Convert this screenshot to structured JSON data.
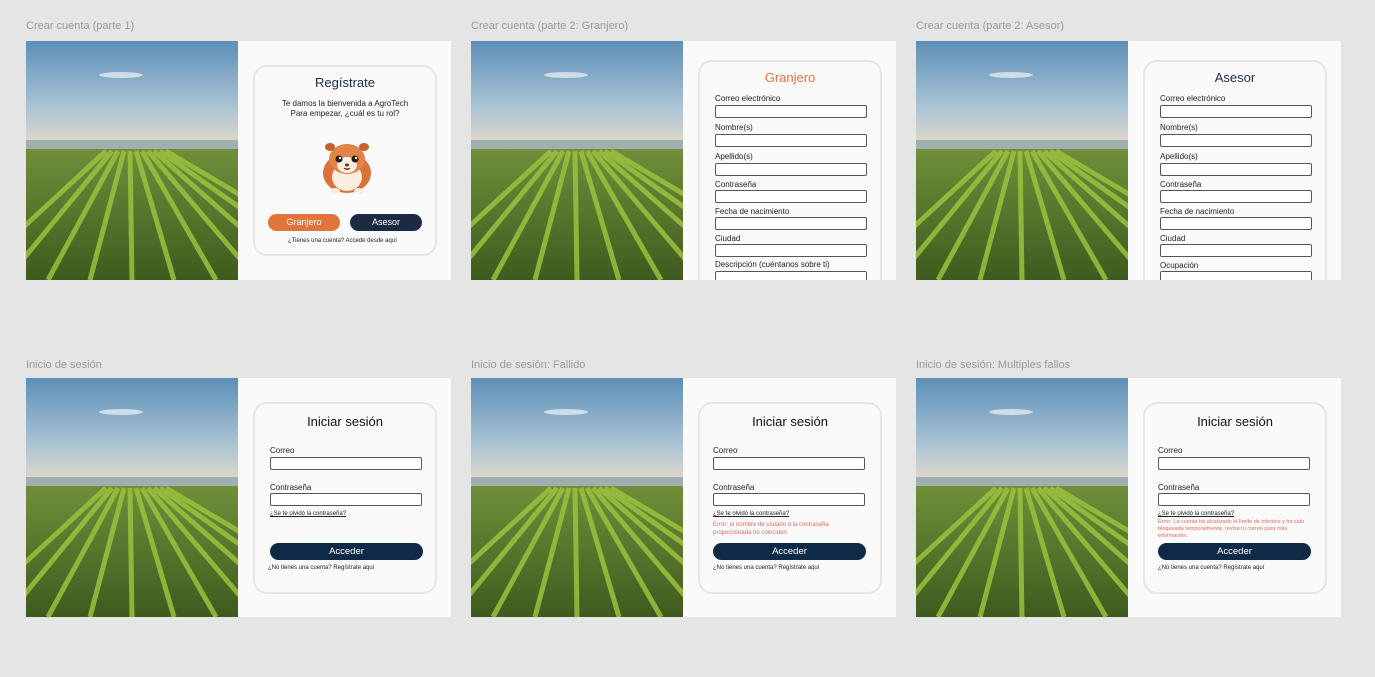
{
  "frames": {
    "register1": {
      "label": "Crear cuenta (parte 1)",
      "title": "Regístrate",
      "welcome_line1": "Te damos la bienvenida a AgroTech",
      "welcome_line2": "Para empezar, ¿cuál es tu rol?",
      "farmer_button": "Granjero",
      "advisor_button": "Asesor",
      "login_link": "¿Tienes una  cuenta? Accede desde aquí"
    },
    "register_farmer": {
      "label": "Crear cuenta (parte 2: Granjero)",
      "title": "Granjero",
      "fields": [
        "Correo electrónico",
        "Nombre(s)",
        "Apellido(s)",
        "Contraseña",
        "Fecha de nacimiento",
        "Ciudad",
        "Descripción (cuéntanos sobre ti)"
      ]
    },
    "register_advisor": {
      "label": "Crear cuenta (parte 2: Asesor)",
      "title": "Asesor",
      "fields": [
        "Correo electrónico",
        "Nombre(s)",
        "Apellido(s)",
        "Contraseña",
        "Fecha de nacimiento",
        "Ciudad",
        "Ocupación"
      ]
    },
    "login": {
      "label": "Inicio de sesión",
      "title": "Iniciar sesión",
      "email_label": "Correo",
      "password_label": "Contraseña",
      "forgot": "¿Se te olvidó la contraseña?",
      "submit": "Acceder",
      "register_link": "¿No tienes una cuenta? Regístrate aquí"
    },
    "login_failed": {
      "label": "Inicio de sesión: Fallido",
      "title": "Iniciar sesión",
      "email_label": "Correo",
      "password_label": "Contraseña",
      "forgot": "¿Se te olvidó la contraseña?",
      "error": "Error: el nombre de usuario o la contraseña proporcionada no coinciden.",
      "submit": "Acceder",
      "register_link": "¿No tienes una cuenta? Regístrate aquí"
    },
    "login_locked": {
      "label": "Inicio de sesión: Multiples fallos",
      "title": "Iniciar sesión",
      "email_label": "Correo",
      "password_label": "Contraseña",
      "forgot": "¿Se te olvidó la contraseña?",
      "error": "Error: La cuenta ha alcanzado el límite de intentos y ha sido bloqueada temporalmente, revisa tu correo para más información.",
      "submit": "Acceder",
      "register_link": "¿No tienes una cuenta? Regístrate aquí"
    }
  },
  "colors": {
    "canvas": "#e5e5e5",
    "navy": "#0e2a47",
    "advisor_button": "#1d2a44",
    "orange": "#e0743a",
    "error": "#e26a5f"
  },
  "icons": {
    "mascot": "guinea-pig-mascot",
    "photo": "crop-field-photo"
  }
}
